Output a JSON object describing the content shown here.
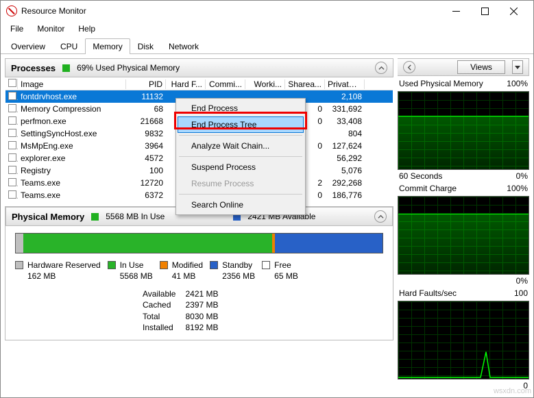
{
  "window": {
    "title": "Resource Monitor"
  },
  "menus": [
    "File",
    "Monitor",
    "Help"
  ],
  "tabs": [
    "Overview",
    "CPU",
    "Memory",
    "Disk",
    "Network"
  ],
  "active_tab": 2,
  "processes_panel": {
    "title": "Processes",
    "meter_text": "69% Used Physical Memory",
    "meter_color": "#20b020",
    "columns": [
      "Image",
      "PID",
      "Hard F...",
      "Commi...",
      "Worki...",
      "Sharea...",
      "Private ..."
    ],
    "rows": [
      {
        "image": "fontdrvhost.exe",
        "pid": "11132",
        "private": "2,108",
        "sel": true
      },
      {
        "image": "Memory Compression",
        "pid": "68",
        "share": "0",
        "private": "331,692"
      },
      {
        "image": "perfmon.exe",
        "pid": "21668",
        "share": "0",
        "private": "33,408"
      },
      {
        "image": "SettingSyncHost.exe",
        "pid": "9832",
        "private": "804"
      },
      {
        "image": "MsMpEng.exe",
        "pid": "3964",
        "share": "0",
        "private": "127,624"
      },
      {
        "image": "explorer.exe",
        "pid": "4572",
        "private": "56,292"
      },
      {
        "image": "Registry",
        "pid": "100",
        "private": "5,076"
      },
      {
        "image": "Teams.exe",
        "pid": "12720",
        "share": "2",
        "private": "292,268"
      },
      {
        "image": "Teams.exe",
        "pid": "6372",
        "share": "0",
        "private": "186,776"
      }
    ]
  },
  "context_menu": {
    "items": [
      "End Process",
      "End Process Tree",
      "Analyze Wait Chain...",
      "Suspend Process",
      "Resume Process",
      "Search Online"
    ],
    "highlighted": 1,
    "disabled": [
      4
    ]
  },
  "physical_panel": {
    "title": "Physical Memory",
    "in_use_text": "5568 MB In Use",
    "in_use_color": "#20b020",
    "available_text": "2421 MB Available",
    "available_color": "#2861c7",
    "bar": [
      {
        "color": "#bfbfbf",
        "pct": 2
      },
      {
        "color": "#29b329",
        "pct": 68
      },
      {
        "color": "#f08000",
        "pct": 0.6
      },
      {
        "color": "#2861c7",
        "pct": 29.4
      }
    ],
    "legend": [
      {
        "name": "Hardware Reserved",
        "value": "162 MB",
        "color": "#bfbfbf"
      },
      {
        "name": "In Use",
        "value": "5568 MB",
        "color": "#29b329"
      },
      {
        "name": "Modified",
        "value": "41 MB",
        "color": "#f08000"
      },
      {
        "name": "Standby",
        "value": "2356 MB",
        "color": "#2861c7"
      },
      {
        "name": "Free",
        "value": "65 MB",
        "color": "#ffffff"
      }
    ],
    "stats": {
      "labels": [
        "Available",
        "Cached",
        "Total",
        "Installed"
      ],
      "values": [
        "2421 MB",
        "2397 MB",
        "8030 MB",
        "8192 MB"
      ]
    }
  },
  "right_panel": {
    "views_label": "Views",
    "graphs": [
      {
        "title": "Used Physical Memory",
        "right": "100%",
        "footer_left": "60 Seconds",
        "footer_right": "0%",
        "fill": 70,
        "spike": false
      },
      {
        "title": "Commit Charge",
        "right": "100%",
        "footer_left": "",
        "footer_right": "0%",
        "fill": 78,
        "spike": false
      },
      {
        "title": "Hard Faults/sec",
        "right": "100",
        "footer_left": "",
        "footer_right": "0",
        "fill": 2,
        "spike": true
      }
    ]
  },
  "chart_data": [
    {
      "type": "area",
      "title": "Used Physical Memory",
      "ylabel": "",
      "ylim": [
        0,
        100
      ],
      "x": "60 Seconds",
      "values_pct": 70
    },
    {
      "type": "area",
      "title": "Commit Charge",
      "ylabel": "",
      "ylim": [
        0,
        100
      ],
      "values_pct": 78
    },
    {
      "type": "line",
      "title": "Hard Faults/sec",
      "ylabel": "",
      "ylim": [
        0,
        100
      ],
      "baseline": 0,
      "spike_value": 35
    }
  ],
  "watermark": "wsxdn.com"
}
